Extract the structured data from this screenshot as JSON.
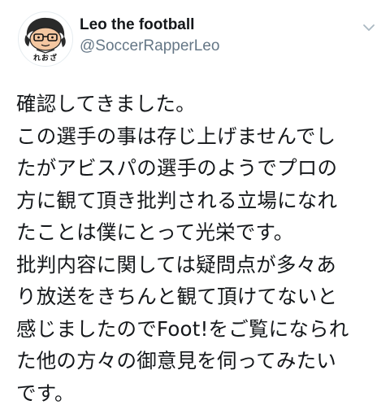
{
  "user": {
    "display_name": "Leo the football",
    "handle": "@SoccerRapperLeo",
    "avatar_caption": "れおざ",
    "avatar_icon": "cartoon-face-avatar"
  },
  "menu": {
    "icon": "chevron-down-icon"
  },
  "tweet": {
    "lines": [
      "確認してきました。",
      "この選手の事は存じ上げませんでし",
      "たがアビスパの選手のようでプロの",
      "方に観て頂き批判される立場になれ",
      "たことは僕にとって光栄です。",
      "批判内容に関しては疑問点が多々あ",
      "り放送をきちんと観て頂けてないと",
      "感じましたのでFoot!をご覧になられ",
      "た他の方々の御意見を伺ってみたい",
      "です。"
    ]
  },
  "colors": {
    "text": "#14171a",
    "secondary": "#657786",
    "chevron": "#aab8c2"
  }
}
